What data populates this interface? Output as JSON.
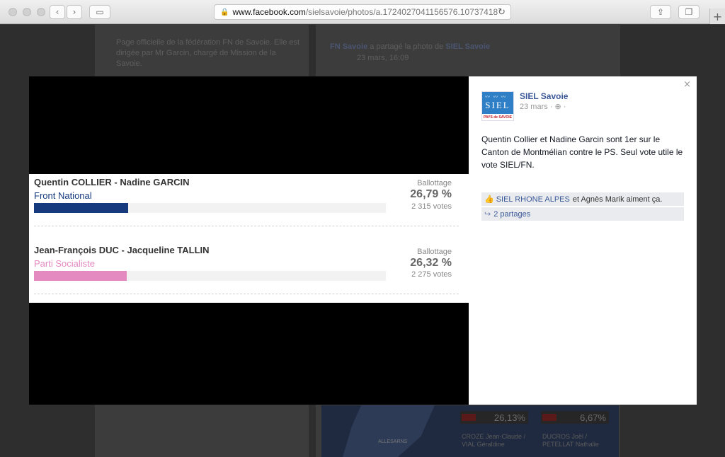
{
  "browser": {
    "url_domain": "www.facebook.com",
    "url_path": "/sielsavoie/photos/a.1724027041156576.10737418",
    "lock_icon": "lock-icon",
    "reload_icon": "reload-icon"
  },
  "background": {
    "page_description": "Page officielle de la fédération FN de Savoie. Elle est dirigée par Mr Garcin, chargé de Mission de la Savoie.",
    "share_author": "FN Savoie",
    "share_action": "a partagé la photo de",
    "share_target": "SIEL Savoie",
    "share_date": "23 mars, 16:09",
    "map_place": "ALLESARNS",
    "pct_left": "26,13%",
    "pct_right": "6,67%",
    "cand_left": "CROZE Jean-Claude / VIAL Géraldine",
    "cand_right": "DUCROS Joël / PETELLAT Nathalie"
  },
  "results": {
    "row1": {
      "candidates": "Quentin COLLIER - Nadine GARCIN",
      "party": "Front National",
      "status": "Ballottage",
      "percent_text": "26,79 %",
      "votes_text": "2 315 votes",
      "percent_value": 26.79,
      "color": "#163a7e"
    },
    "row2": {
      "candidates": "Jean-François DUC - Jacqueline TALLIN",
      "party": "Parti Socialiste",
      "status": "Ballottage",
      "percent_text": "26,32 %",
      "votes_text": "2 275 votes",
      "percent_value": 26.32,
      "color": "#e58ac0"
    }
  },
  "post": {
    "page_name": "SIEL Savoie",
    "date": "23 mars",
    "separator": "·",
    "globe_icon": "globe-icon",
    "dot": "·",
    "logo_text": "SIEL",
    "logo_sub": "PAYS de SAVOIE",
    "text": "Quentin Collier et Nadine Garcin sont 1er sur le Canton de Montmélian contre le PS. Seul vote utile le vote SIEL/FN.",
    "likes_link": "SIEL RHONE ALPES",
    "likes_rest": "et Agnès Marik aiment ça.",
    "shares": "2 partages",
    "close": "×"
  }
}
